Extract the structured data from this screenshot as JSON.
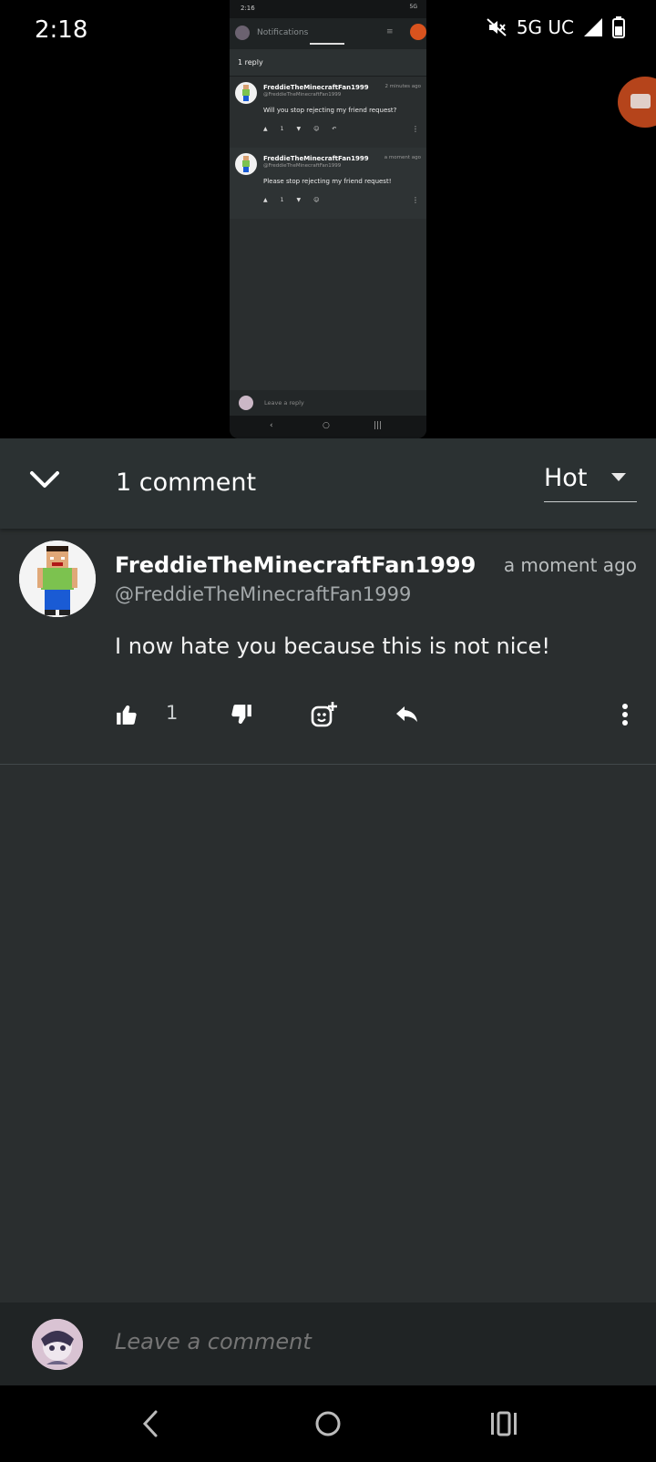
{
  "status_bar": {
    "time": "2:18",
    "network": "5G UC",
    "icons": [
      "mute-icon",
      "signal-icon",
      "battery-icon"
    ]
  },
  "embedded_screen": {
    "time": "2:16",
    "network": "5G",
    "app_title": "Notifications",
    "reply_header": "1 reply",
    "comments": [
      {
        "author": "FreddieTheMinecraftFan1999",
        "handle": "@FreddieTheMinecraftFan1999",
        "time": "2 minutes ago",
        "text": "Will you stop rejecting my friend request?",
        "likes": "1"
      },
      {
        "author": "FreddieTheMinecraftFan1999",
        "handle": "@FreddieTheMinecraftFan1999",
        "time": "a moment ago",
        "text": "Please stop rejecting my friend request!",
        "likes": "1"
      }
    ],
    "leave_reply_placeholder": "Leave a reply"
  },
  "comments_panel": {
    "count_label": "1 comment",
    "sort": {
      "selected": "Hot"
    }
  },
  "comments": [
    {
      "author": "FreddieTheMinecraftFan1999",
      "handle": "@FreddieTheMinecraftFan1999",
      "time": "a moment ago",
      "text": "I now hate you because this is not nice!",
      "likes": "1"
    }
  ],
  "composer": {
    "placeholder": "Leave a comment"
  },
  "colors": {
    "panel_bg": "#2a2e2f",
    "header_bg": "#2b3132",
    "composer_bg": "#202425",
    "accent_orange": "#d9531e"
  }
}
